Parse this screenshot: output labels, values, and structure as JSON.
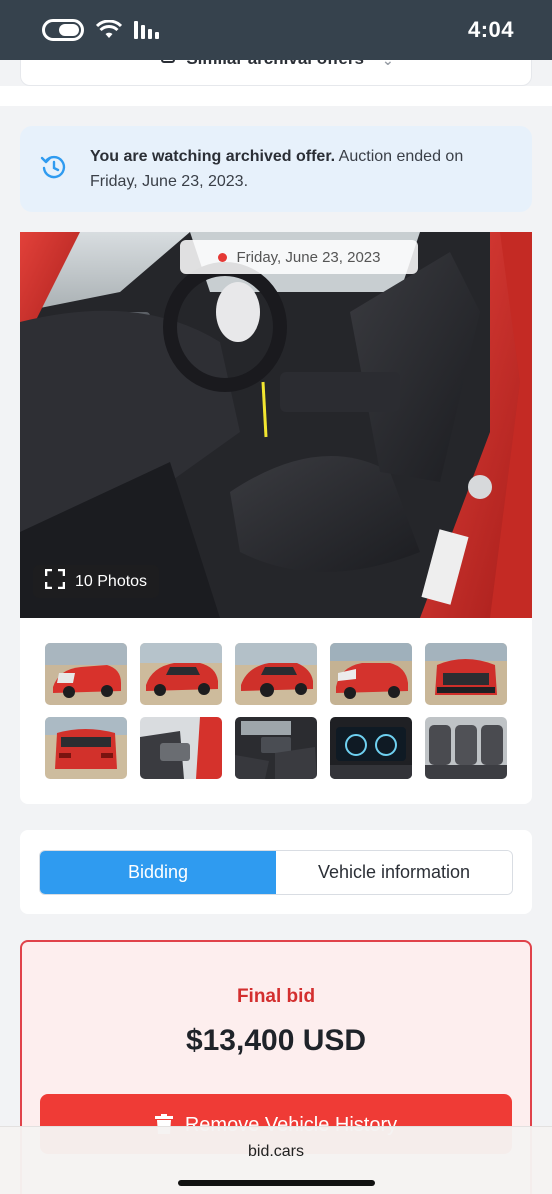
{
  "status_bar": {
    "time": "4:04"
  },
  "similar_offers": {
    "label": "Similar archival offers"
  },
  "archived_notice": {
    "bold_text": "You are watching archived offer.",
    "text": " Auction ended on Friday, June 23, 2023."
  },
  "gallery": {
    "date": "Friday, June 23, 2023",
    "photos_count": "10 Photos",
    "thumbnails": [
      {
        "view": "front-left-damaged"
      },
      {
        "view": "side-right"
      },
      {
        "view": "rear-right"
      },
      {
        "view": "front-right"
      },
      {
        "view": "front"
      },
      {
        "view": "rear"
      },
      {
        "view": "interior-door"
      },
      {
        "view": "interior-front"
      },
      {
        "view": "dashboard-cluster"
      },
      {
        "view": "rear-seats"
      }
    ]
  },
  "tabs": [
    {
      "label": "Bidding",
      "active": true
    },
    {
      "label": "Vehicle information",
      "active": false
    }
  ],
  "bid": {
    "label": "Final bid",
    "value": "$13,400 USD",
    "remove_button": "Remove Vehicle History"
  },
  "browser": {
    "url": "bid.cars"
  },
  "colors": {
    "accent": "#2f9bf0",
    "danger": "#ef3b36",
    "notice_bg": "#e7f1fb",
    "status_bar": "#36424d"
  }
}
